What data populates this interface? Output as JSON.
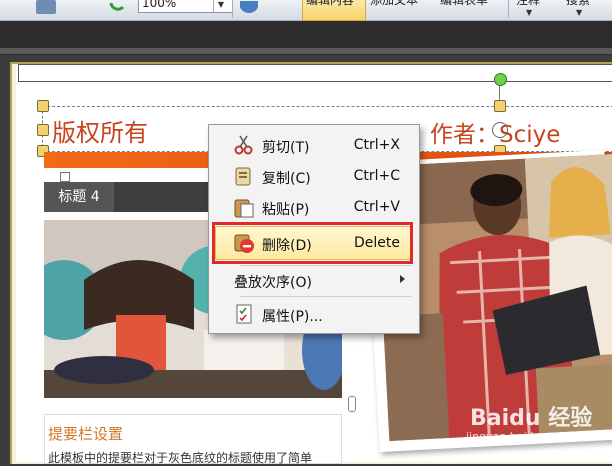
{
  "toolbar": {
    "zoom_value": "100%",
    "buttons": [
      "编辑内容",
      "添加文本",
      "编辑表单",
      "注释",
      "搜索"
    ]
  },
  "document": {
    "header_title": "版权所有",
    "author_label": "作者：",
    "author_name": "Sciye",
    "section_label": "标题 4",
    "sidebar_title": "提要栏设置",
    "sidebar_text": "此模板中的提要栏对于灰色底纹的标题使用了简单"
  },
  "context_menu": {
    "items": [
      {
        "label": "剪切(T)",
        "shortcut": "Ctrl+X",
        "icon": "scissors-icon"
      },
      {
        "label": "复制(C)",
        "shortcut": "Ctrl+C",
        "icon": "copy-icon"
      },
      {
        "label": "粘贴(P)",
        "shortcut": "Ctrl+V",
        "icon": "paste-icon"
      },
      {
        "label": "删除(D)",
        "shortcut": "Delete",
        "icon": "delete-icon"
      },
      {
        "label": "叠放次序(O)",
        "shortcut": "",
        "icon": ""
      },
      {
        "label": "属性(P)...",
        "shortcut": "",
        "icon": "properties-icon"
      }
    ],
    "highlighted_item": "删除(D)"
  },
  "watermark": {
    "line1": "Baidu 经验",
    "line2": "jingyan.baidu.com"
  },
  "colors": {
    "accent_orange": "#e85812",
    "title_red": "#c8431f",
    "highlight_red": "#e0282d",
    "selection_yellow": "#f3d170"
  }
}
